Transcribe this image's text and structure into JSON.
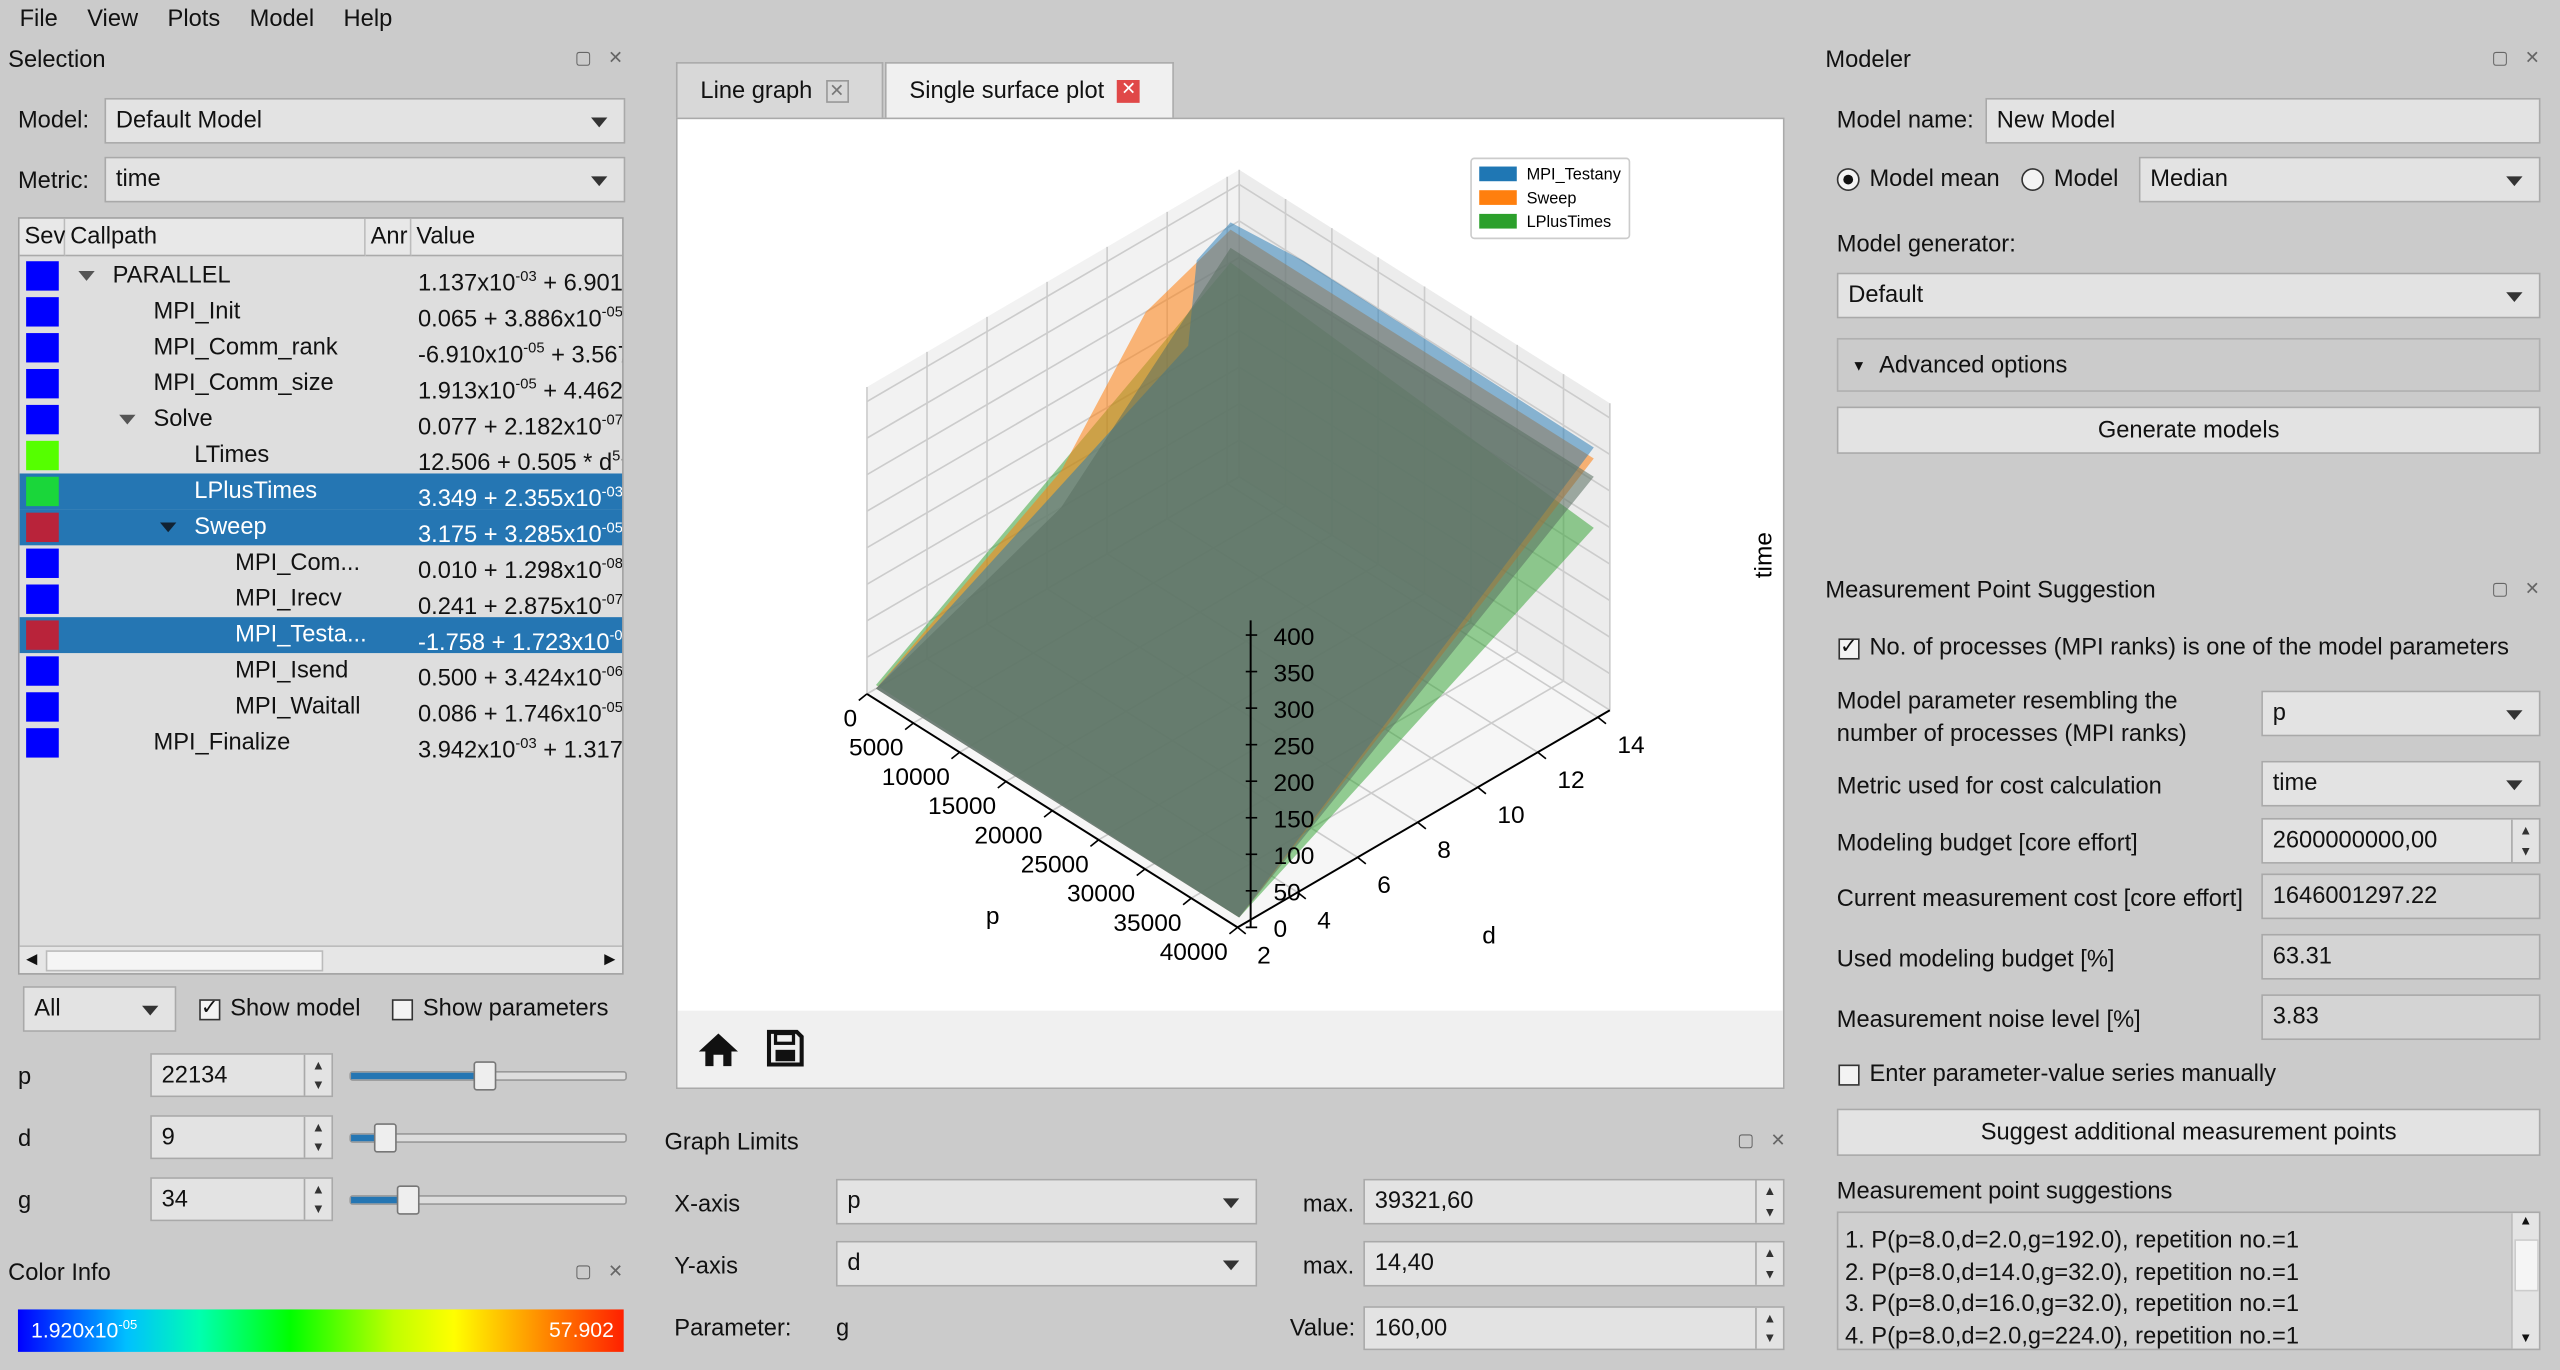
{
  "menu": [
    "File",
    "View",
    "Plots",
    "Model",
    "Help"
  ],
  "selection": {
    "title": "Selection",
    "model_label": "Model:",
    "model_value": "Default Model",
    "metric_label": "Metric:",
    "metric_value": "time",
    "columns": [
      "Sev",
      "Callpath",
      "Anr",
      "Value"
    ],
    "rows": [
      {
        "name": "PARALLEL",
        "level": 0,
        "expand": true,
        "sev": "#0000ff",
        "sel": false,
        "value": [
          {
            "t": "1.137x10"
          },
          {
            "s": "-03"
          },
          {
            "t": " + 6.901"
          }
        ]
      },
      {
        "name": "MPI_Init",
        "level": 1,
        "sev": "#0000ff",
        "sel": false,
        "value": [
          {
            "t": "0.065 + 3.886x10"
          },
          {
            "s": "-05"
          }
        ]
      },
      {
        "name": "MPI_Comm_rank",
        "level": 1,
        "sev": "#0000ff",
        "sel": false,
        "value": [
          {
            "t": "-6.910x10"
          },
          {
            "s": "-05"
          },
          {
            "t": " + 3.567"
          }
        ]
      },
      {
        "name": "MPI_Comm_size",
        "level": 1,
        "sev": "#0000ff",
        "sel": false,
        "value": [
          {
            "t": "1.913x10"
          },
          {
            "s": "-05"
          },
          {
            "t": " + 4.462"
          }
        ]
      },
      {
        "name": "Solve",
        "level": 1,
        "expand": true,
        "sev": "#0000ff",
        "sel": false,
        "value": [
          {
            "t": "0.077 + 2.182x10"
          },
          {
            "s": "-07"
          }
        ]
      },
      {
        "name": "LTimes",
        "level": 2,
        "sev": "#55ff00",
        "sel": false,
        "value": [
          {
            "t": "12.506 + 0.505 * d"
          },
          {
            "s": "5."
          }
        ]
      },
      {
        "name": "LPlusTimes",
        "level": 2,
        "sev": "#1ad63a",
        "sel": true,
        "value": [
          {
            "t": "3.349 + 2.355x10"
          },
          {
            "s": "-03"
          }
        ]
      },
      {
        "name": "Sweep",
        "level": 2,
        "expand": true,
        "sev": "#b9233a",
        "sel": true,
        "value": [
          {
            "t": "3.175 + 3.285x10"
          },
          {
            "s": "-05"
          }
        ]
      },
      {
        "name": "MPI_Com...",
        "level": 3,
        "sev": "#0000ff",
        "sel": false,
        "value": [
          {
            "t": "0.010 + 1.298x10"
          },
          {
            "s": "-08"
          }
        ]
      },
      {
        "name": "MPI_Irecv",
        "level": 3,
        "sev": "#0000ff",
        "sel": false,
        "value": [
          {
            "t": "0.241 + 2.875x10"
          },
          {
            "s": "-07"
          }
        ]
      },
      {
        "name": "MPI_Testa...",
        "level": 3,
        "sev": "#b9233a",
        "sel": true,
        "value": [
          {
            "t": "-1.758 + 1.723x10"
          },
          {
            "s": "-0"
          }
        ]
      },
      {
        "name": "MPI_Isend",
        "level": 3,
        "sev": "#0000ff",
        "sel": false,
        "value": [
          {
            "t": "0.500 + 3.424x10"
          },
          {
            "s": "-06"
          }
        ]
      },
      {
        "name": "MPI_Waitall",
        "level": 3,
        "sev": "#0000ff",
        "sel": false,
        "value": [
          {
            "t": "0.086 + 1.746x10"
          },
          {
            "s": "-05"
          }
        ]
      },
      {
        "name": "MPI_Finalize",
        "level": 1,
        "sev": "#0000ff",
        "sel": false,
        "value": [
          {
            "t": "3.942x10"
          },
          {
            "s": "-03"
          },
          {
            "t": " + 1.317"
          }
        ]
      }
    ],
    "filter_value": "All",
    "show_model": "Show model",
    "show_model_checked": true,
    "show_parameters": "Show parameters",
    "show_parameters_checked": false,
    "params": [
      {
        "name": "p",
        "value": "22134",
        "slider_fraction": 0.48
      },
      {
        "name": "d",
        "value": "9",
        "slider_fraction": 0.12
      },
      {
        "name": "g",
        "value": "34",
        "slider_fraction": 0.2
      }
    ]
  },
  "color_info": {
    "title": "Color Info",
    "min_base": "1.920x10",
    "min_exp": "-05",
    "max": "57.902"
  },
  "tabs": [
    {
      "label": "Line graph",
      "active": false
    },
    {
      "label": "Single surface plot",
      "active": true
    }
  ],
  "toolbar": {
    "home": "home-icon",
    "save": "save-icon"
  },
  "chart_data": {
    "type": "surface",
    "series": [
      {
        "name": "MPI_Testany",
        "color": "#1f77b4"
      },
      {
        "name": "Sweep",
        "color": "#ff7f0e"
      },
      {
        "name": "LPlusTimes",
        "color": "#2ca02c"
      }
    ],
    "xlabel": "p",
    "ylabel": "d",
    "zlabel": "time",
    "xticks": [
      "0",
      "5000",
      "10000",
      "15000",
      "20000",
      "25000",
      "30000",
      "35000",
      "40000"
    ],
    "yticks": [
      "2",
      "4",
      "6",
      "8",
      "10",
      "12",
      "14"
    ],
    "zticks": [
      "0",
      "50",
      "100",
      "150",
      "200",
      "250",
      "300",
      "350",
      "400"
    ],
    "xlim": [
      0,
      40000
    ],
    "ylim": [
      2,
      14.4
    ],
    "zlim": [
      0,
      420
    ],
    "legend": "top-right",
    "grid": true
  },
  "graph_limits": {
    "title": "Graph Limits",
    "x_label": "X-axis",
    "x_value": "p",
    "x_max_label": "max.",
    "x_max": "39321,60",
    "y_label": "Y-axis",
    "y_value": "d",
    "y_max_label": "max.",
    "y_max": "14,40",
    "param_label": "Parameter:",
    "param_value": "g",
    "value_label": "Value:",
    "value": "160,00"
  },
  "modeler": {
    "title": "Modeler",
    "name_label": "Model name:",
    "name_value": "New Model",
    "mean_label": "Model mean",
    "median_label": "Model",
    "median_value": "Median",
    "mean_selected": true,
    "generator_label": "Model generator:",
    "generator_value": "Default",
    "advanced": "Advanced options",
    "generate": "Generate models"
  },
  "mps": {
    "title": "Measurement Point Suggestion",
    "mpi_check": "No. of processes (MPI ranks) is one of the model parameters",
    "mpi_checked": true,
    "rows": [
      {
        "label": "Model parameter resembling the\nnumber of processes (MPI ranks)",
        "value": "p",
        "kind": "combo"
      },
      {
        "label": "Metric used for cost calculation",
        "value": "time",
        "kind": "combo"
      },
      {
        "label": "Modeling budget [core effort]",
        "value": "2600000000,00",
        "kind": "spin"
      },
      {
        "label": "Current measurement cost [core effort]",
        "value": "1646001297.22",
        "kind": "text"
      },
      {
        "label": "Used modeling budget [%]",
        "value": "63.31",
        "kind": "text"
      },
      {
        "label": "Measurement noise level [%]",
        "value": "3.83",
        "kind": "text"
      }
    ],
    "manual": "Enter parameter-value series manually",
    "manual_checked": false,
    "suggest": "Suggest additional measurement points",
    "list_label": "Measurement point suggestions",
    "suggestions": [
      "1. P(p=8.0,d=2.0,g=192.0), repetition no.=1",
      "2. P(p=8.0,d=14.0,g=32.0), repetition no.=1",
      "3. P(p=8.0,d=16.0,g=32.0), repetition no.=1",
      "4. P(p=8.0,d=2.0,g=224.0), repetition no.=1"
    ]
  }
}
